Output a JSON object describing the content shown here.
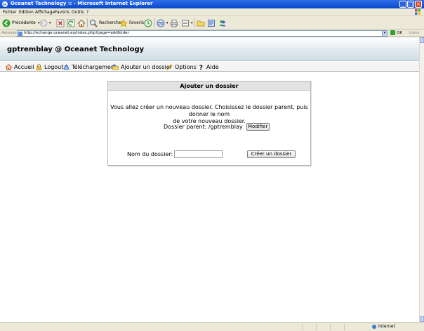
{
  "window": {
    "title": "Oceanet Technology :: - Microsoft Internet Explorer",
    "controls": [
      "_",
      "□",
      "×"
    ]
  },
  "menu": [
    "Fichier",
    "Edition",
    "Affichage",
    "Favoris",
    "Outils",
    "?"
  ],
  "toolbar": {
    "back_label": "Précédente",
    "search_label": "Rechercher",
    "favorites_label": "Favoris"
  },
  "address": {
    "label": "Adresse",
    "url": "http://echange.oceanet.eu/index.php?page=addfolder",
    "go_label": "OK",
    "links_label": "Liens"
  },
  "site": {
    "brand": "gptremblay @ Oceanet Technology",
    "nav": [
      {
        "label": "Accueil",
        "icon": "home-icon"
      },
      {
        "label": "Logout",
        "icon": "lock-icon"
      },
      {
        "label": "Téléchargement",
        "icon": "upload-icon"
      },
      {
        "label": "Ajouter un dossier",
        "icon": "add-folder-icon"
      },
      {
        "label": "Options",
        "icon": "options-icon"
      },
      {
        "label": "Aide",
        "icon": "help-icon"
      }
    ]
  },
  "panel": {
    "title": "Ajouter un dossier",
    "message_line1": "Vous allez créer un nouveau dossier. Choisissez le dossier parent, puis donner le nom",
    "message_line2": "de votre nouveau dossier.",
    "parent_label": "Dossier parent: /gptremblay",
    "modify_button": "Modifier",
    "name_label": "Nom du dossier:",
    "name_value": "",
    "create_button": "Créer un dossier"
  },
  "status": {
    "zone": "Internet"
  }
}
